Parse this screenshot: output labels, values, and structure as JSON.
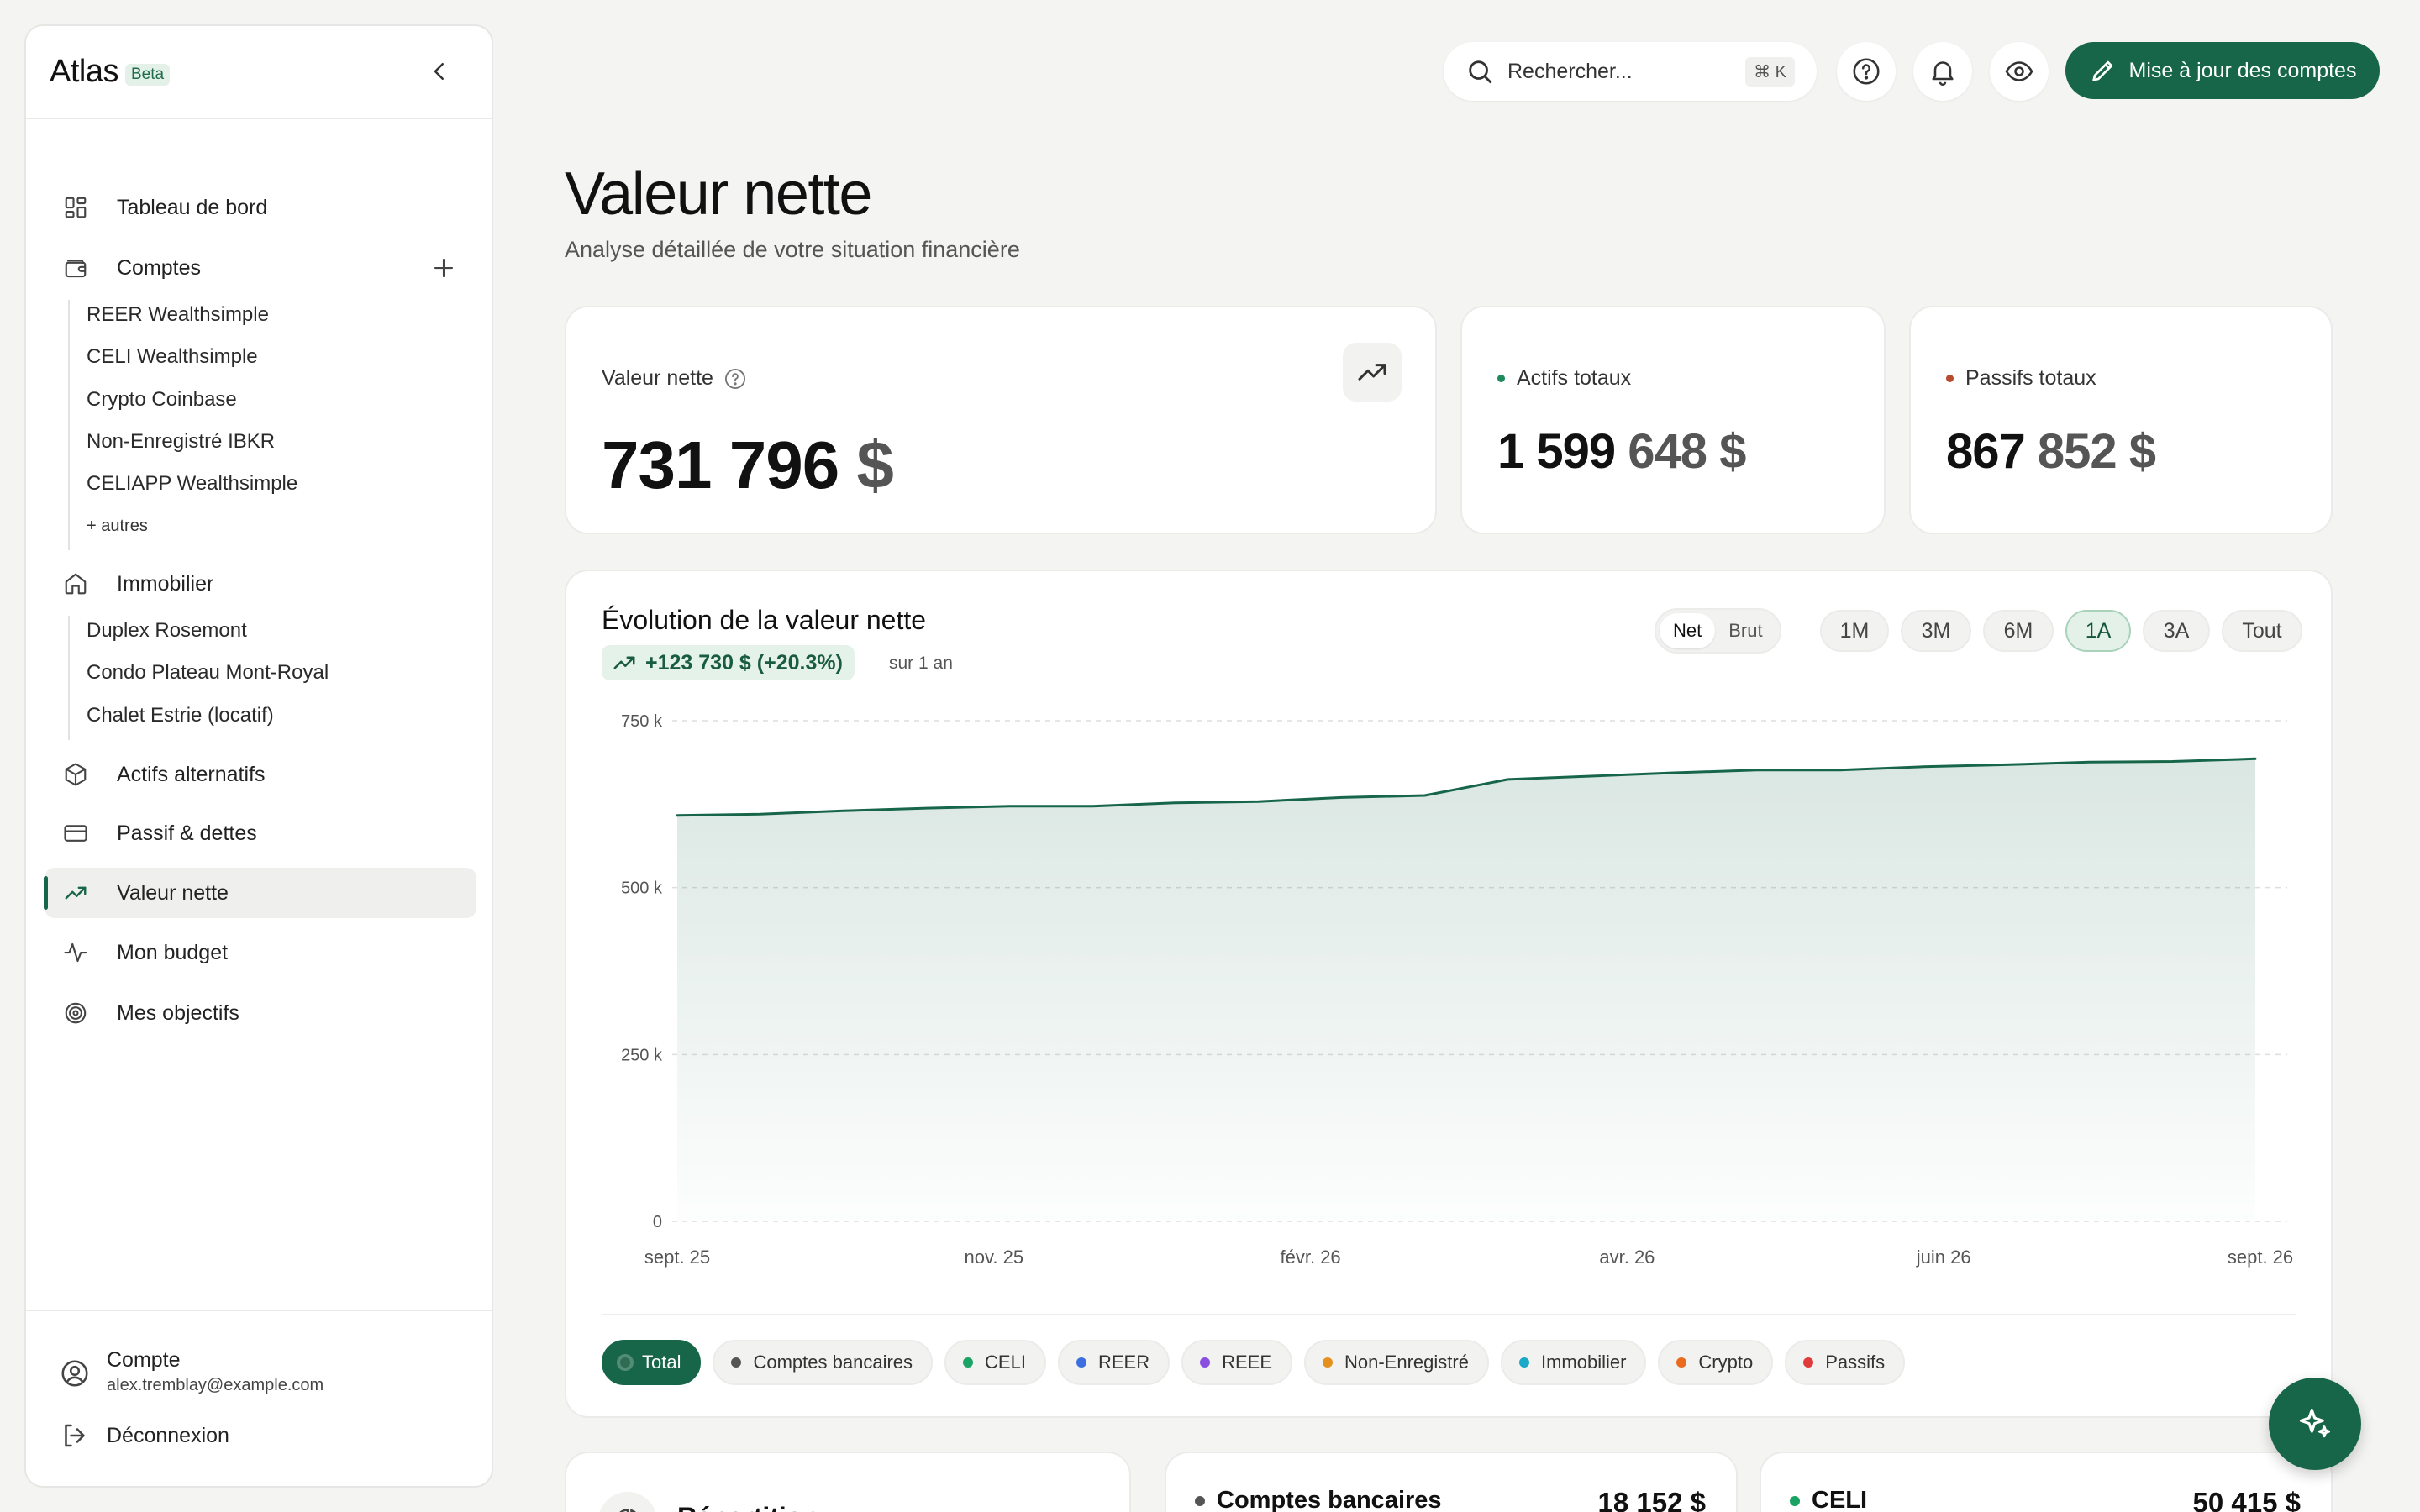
{
  "brand": {
    "name": "Atlas",
    "badge": "Beta"
  },
  "sidebar": {
    "dashboard": "Tableau de bord",
    "accounts": {
      "label": "Comptes",
      "items": [
        "REER Wealthsimple",
        "CELI Wealthsimple",
        "Crypto Coinbase",
        "Non-Enregistré IBKR",
        "CELIAPP Wealthsimple"
      ],
      "more": "+ autres"
    },
    "real_estate": {
      "label": "Immobilier",
      "items": [
        "Duplex Rosemont",
        "Condo Plateau Mont-Royal",
        "Chalet Estrie (locatif)"
      ]
    },
    "alternatives": "Actifs alternatifs",
    "liabilities": "Passif & dettes",
    "net_worth": "Valeur nette",
    "budget": "Mon budget",
    "goals": "Mes objectifs",
    "account": {
      "title": "Compte",
      "email": "alex.tremblay@example.com"
    },
    "logout": "Déconnexion"
  },
  "topbar": {
    "search_placeholder": "Rechercher...",
    "search_shortcut": "⌘ K",
    "update_button": "Mise à jour des comptes"
  },
  "page": {
    "title": "Valeur nette",
    "subtitle": "Analyse détaillée de votre situation financière"
  },
  "kpis": {
    "net_worth": {
      "label": "Valeur nette",
      "main": "731 796",
      "currency": "$"
    },
    "assets": {
      "label": "Actifs totaux",
      "main": "1 599",
      "tail": "648 $"
    },
    "liabilities": {
      "label": "Passifs totaux",
      "main": "867",
      "tail": "852 $"
    }
  },
  "chart": {
    "title": "Évolution de la valeur nette",
    "delta": "+123 730 $ (+20.3%)",
    "delta_note": "sur 1 an",
    "toggle": [
      "Net",
      "Brut"
    ],
    "ranges": [
      "1M",
      "3M",
      "6M",
      "1A",
      "3A",
      "Tout"
    ],
    "active_range": "1A",
    "legend": [
      "Total",
      "Comptes bancaires",
      "CELI",
      "REER",
      "REEE",
      "Non-Enregistré",
      "Immobilier",
      "Crypto",
      "Passifs"
    ]
  },
  "colors": {
    "accent": "#17664a",
    "assets_dot": "#1f8a5b",
    "liabilities_dot": "#b84a2e",
    "legend": [
      "#2d6b52",
      "#555555",
      "#1aa364",
      "#3b6fe0",
      "#8a4fe0",
      "#e5901a",
      "#18a8c8",
      "#ea6b1d",
      "#e03a3a"
    ]
  },
  "chart_data": {
    "type": "area",
    "x_ticks": [
      "sept. 25",
      "nov. 25",
      "févr. 26",
      "avr. 26",
      "juin 26",
      "sept. 26"
    ],
    "y_ticks": [
      "0",
      "250 k",
      "500 k",
      "750 k"
    ],
    "ylim": [
      0,
      750000
    ],
    "series": [
      {
        "name": "Total",
        "values": [
          608000,
          610000,
          615000,
          619000,
          622000,
          622000,
          627000,
          629000,
          635000,
          638000,
          662000,
          667000,
          672000,
          676000,
          676000,
          681000,
          684000,
          688000,
          689000,
          693000
        ]
      }
    ]
  },
  "bottom_cards": {
    "breakdown_title": "Répartition",
    "bank": {
      "label": "Comptes bancaires",
      "value": "18 152 $"
    },
    "celi": {
      "label": "CELI",
      "value": "50 415 $"
    }
  }
}
